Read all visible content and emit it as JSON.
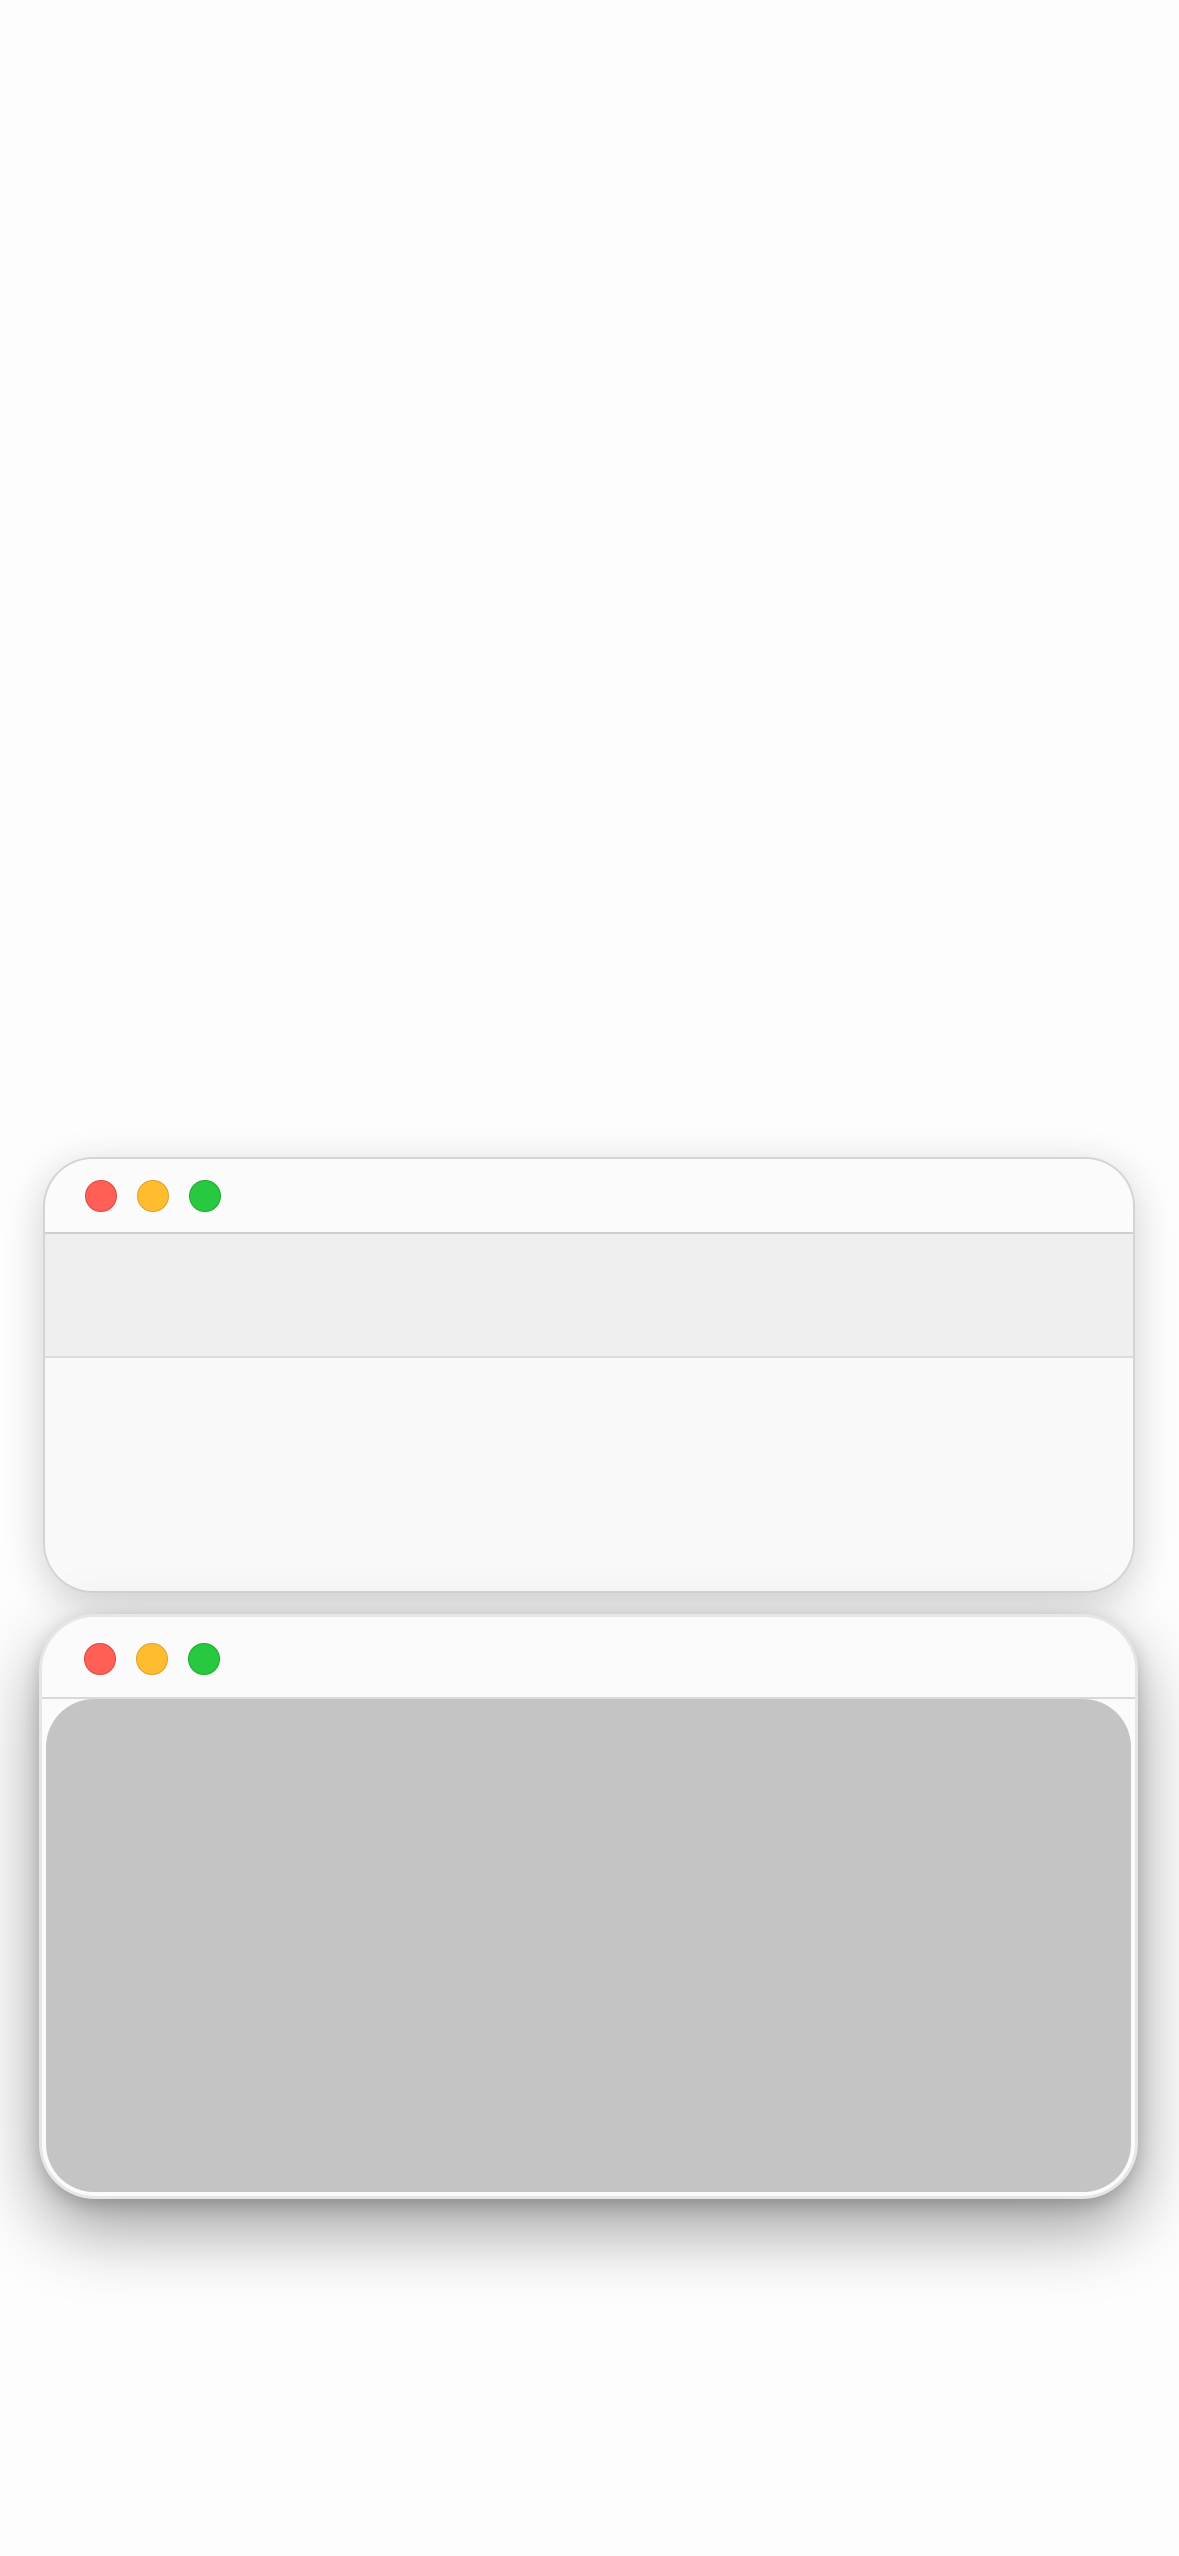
{
  "windows": [
    {
      "id": "window-front-top",
      "controls": [
        "close-icon",
        "minimize-icon",
        "zoom-icon"
      ],
      "has_toolbar": true
    },
    {
      "id": "window-bottom",
      "controls": [
        "close-icon",
        "minimize-icon",
        "zoom-icon"
      ],
      "has_toolbar": false
    }
  ],
  "colors": {
    "background": "#fdfdfd",
    "close": "#ff5f57",
    "minimize": "#febc2e",
    "zoom": "#28c840",
    "toolbar": "#efefef",
    "content_gray": "#c4c4c4"
  }
}
